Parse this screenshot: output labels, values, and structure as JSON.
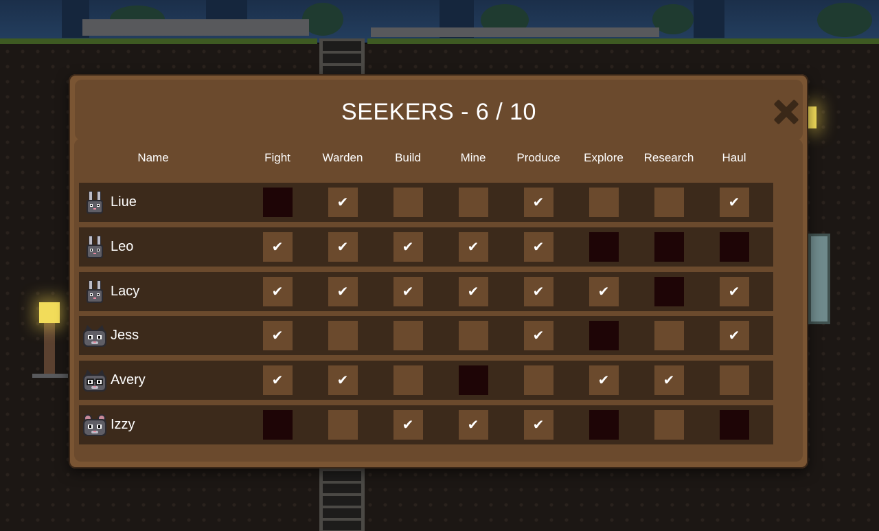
{
  "dialog": {
    "title": "SEEKERS - 6 / 10"
  },
  "columns": [
    {
      "key": "fight",
      "label": "Fight"
    },
    {
      "key": "warden",
      "label": "Warden"
    },
    {
      "key": "build",
      "label": "Build"
    },
    {
      "key": "mine",
      "label": "Mine"
    },
    {
      "key": "produce",
      "label": "Produce"
    },
    {
      "key": "explore",
      "label": "Explore"
    },
    {
      "key": "research",
      "label": "Research"
    },
    {
      "key": "haul",
      "label": "Haul"
    }
  ],
  "name_header": "Name",
  "check_glyph": "✔",
  "seekers": [
    {
      "name": "Liue",
      "species": "rabbit",
      "jobs": [
        "disabled",
        "on",
        "off",
        "off",
        "on",
        "off",
        "off",
        "on"
      ]
    },
    {
      "name": "Leo",
      "species": "rabbit",
      "jobs": [
        "on",
        "on",
        "on",
        "on",
        "on",
        "disabled",
        "disabled",
        "disabled"
      ]
    },
    {
      "name": "Lacy",
      "species": "rabbit",
      "jobs": [
        "on",
        "on",
        "on",
        "on",
        "on",
        "on",
        "disabled",
        "on"
      ]
    },
    {
      "name": "Jess",
      "species": "cat",
      "jobs": [
        "on",
        "off",
        "off",
        "off",
        "on",
        "disabled",
        "off",
        "on"
      ]
    },
    {
      "name": "Avery",
      "species": "cat-glasses",
      "jobs": [
        "on",
        "on",
        "off",
        "disabled",
        "off",
        "on",
        "on",
        "off"
      ]
    },
    {
      "name": "Izzy",
      "species": "mouse",
      "jobs": [
        "disabled",
        "off",
        "on",
        "on",
        "on",
        "disabled",
        "off",
        "disabled"
      ]
    }
  ],
  "colors": {
    "dialog": "#7a5533",
    "panel": "#6b4a2d",
    "row": "#3c2a1b",
    "cell_enabled": "#6b4a2d",
    "cell_disabled": "#1e0506"
  }
}
